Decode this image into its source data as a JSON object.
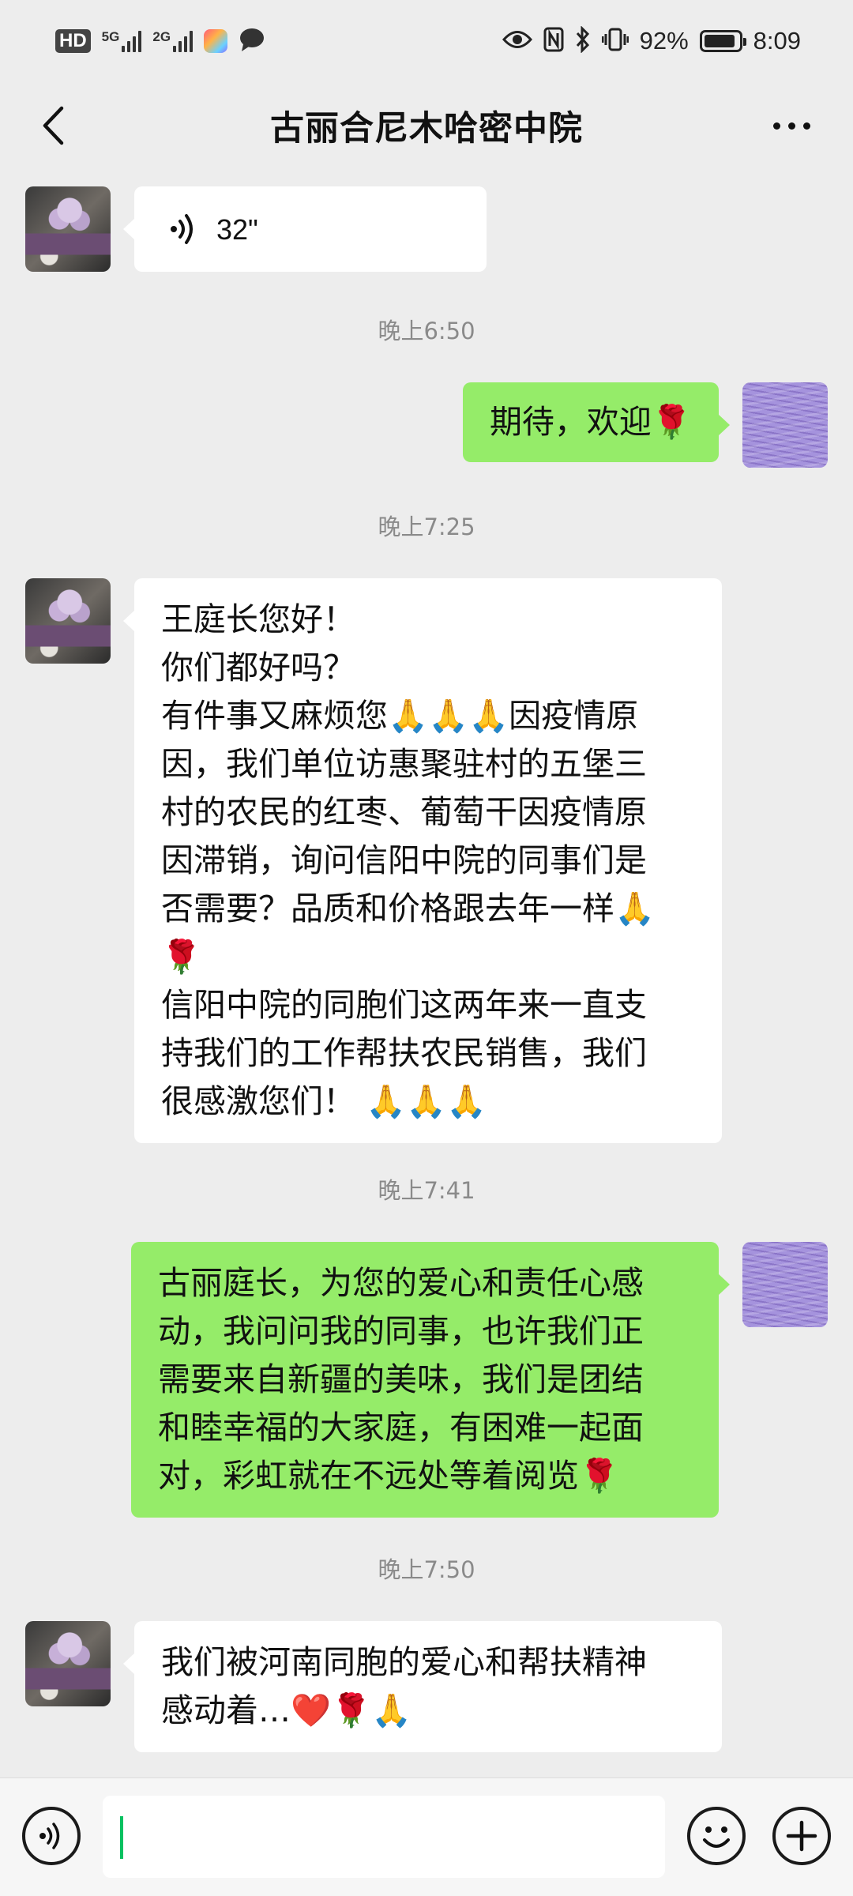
{
  "status_bar": {
    "hd_label": "HD",
    "sim1_network": "5G",
    "sim2_network": "2G",
    "battery_percent_text": "92%",
    "battery_level": 0.92,
    "time": "8:09",
    "icons": [
      "eye-icon",
      "nfc-icon",
      "bluetooth-icon",
      "vibrate-icon"
    ]
  },
  "header": {
    "title": "古丽合尼木哈密中院",
    "back_icon": "chevron-left-icon",
    "more_icon": "more-dots-icon"
  },
  "messages": [
    {
      "type": "voice",
      "side": "left",
      "duration": "32\""
    },
    {
      "type": "timestamp",
      "text": "晚上6:50"
    },
    {
      "type": "text",
      "side": "right",
      "lines": [
        "期待，欢迎🌹"
      ]
    },
    {
      "type": "timestamp",
      "text": "晚上7:25"
    },
    {
      "type": "text",
      "side": "left",
      "lines": [
        "王庭长您好！",
        "你们都好吗？",
        "有件事又麻烦您🙏🙏🙏因疫情原",
        "因，我们单位访惠聚驻村的五堡三",
        "村的农民的红枣、葡萄干因疫情原",
        "因滞销，询问信阳中院的同事们是",
        "否需要？品质和价格跟去年一样🙏",
        "🌹",
        "信阳中院的同胞们这两年来一直支",
        "持我们的工作帮扶农民销售，我们",
        "很感激您们！ 🙏🙏🙏"
      ]
    },
    {
      "type": "timestamp",
      "text": "晚上7:41"
    },
    {
      "type": "text",
      "side": "right",
      "lines": [
        "古丽庭长，为您的爱心和责任心感",
        "动，我问问我的同事，也许我们正",
        "需要来自新疆的美味，我们是团结",
        "和睦幸福的大家庭，有困难一起面",
        "对，彩虹就在不远处等着阅览🌹"
      ]
    },
    {
      "type": "timestamp",
      "text": "晚上7:50"
    },
    {
      "type": "text",
      "side": "left",
      "lines": [
        "我们被河南同胞的爱心和帮扶精神",
        "感动着…❤️🌹🙏"
      ]
    }
  ],
  "input_bar": {
    "voice_icon": "voice-mode-icon",
    "input_value": "",
    "emoji_icon": "emoji-icon",
    "plus_icon": "plus-icon"
  },
  "colors": {
    "background": "#ededed",
    "incoming_bubble": "#ffffff",
    "outgoing_bubble": "#95ec69",
    "timestamp_text": "#8a8a8a",
    "caret": "#07c160"
  }
}
